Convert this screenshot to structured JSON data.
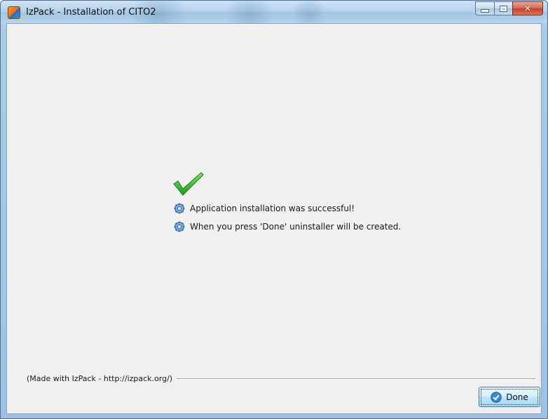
{
  "window": {
    "title": "IzPack - Installation of  CITO2"
  },
  "colors": {
    "titlebar": "#b7d2ec",
    "client_bg": "#f0f0f0",
    "close_button": "#c8412a",
    "checkmark": "#3cc43c",
    "done_button": "#bee6fd"
  },
  "content": {
    "status_icon": "green-checkmark-icon",
    "messages": [
      {
        "icon": "gear-icon",
        "text": "Application installation was successful!"
      },
      {
        "icon": "gear-icon",
        "text": "When you press 'Done' uninstaller will be created."
      }
    ]
  },
  "footer": {
    "credit": "(Made with IzPack - http://izpack.org/)"
  },
  "buttons": {
    "done_label": "Done",
    "done_icon": "blue-check-circle-icon"
  }
}
